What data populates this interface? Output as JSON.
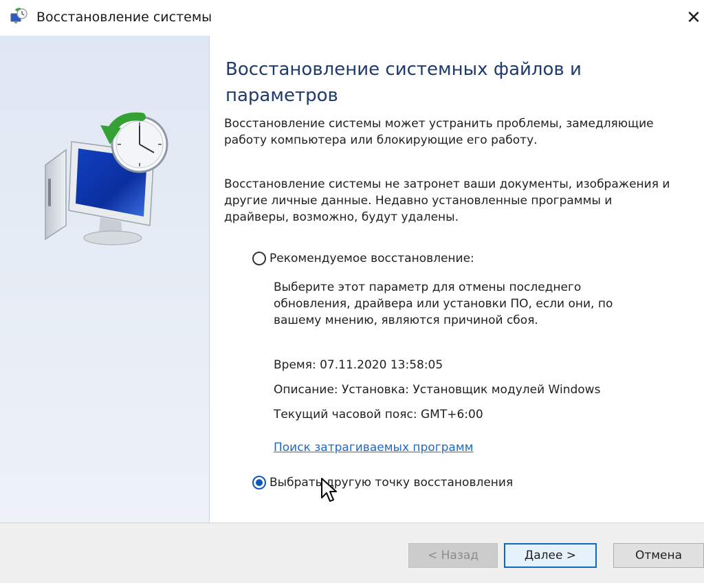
{
  "window": {
    "title": "Восстановление системы",
    "close_glyph": "✕"
  },
  "main": {
    "heading": "Восстановление системных файлов и параметров",
    "intro": "Восстановление системы может устранить проблемы, замедляющие работу компьютера или блокирующие его работу.",
    "note": "Восстановление системы не затронет ваши документы, изображения и другие личные данные. Недавно установленные программы и драйверы, возможно, будут удалены."
  },
  "options": {
    "recommended": {
      "label": "Рекомендуемое восстановление:",
      "selected": false,
      "description": "Выберите этот параметр для отмены последнего обновления, драйвера или установки ПО, если они, по вашему мнению, являются причиной сбоя.",
      "time": "Время: 07.11.2020 13:58:05",
      "desc_line": "Описание: Установка: Установщик модулей Windows",
      "timezone": "Текущий часовой пояс: GMT+6:00",
      "link": "Поиск затрагиваемых программ"
    },
    "other": {
      "label": "Выбрать другую точку восстановления",
      "selected": true
    }
  },
  "buttons": {
    "back": "< Назад",
    "next": "Далее >",
    "cancel": "Отмена"
  },
  "icons": {
    "app": "system-restore-icon",
    "hero": "system-restore-monitor-clock-icon",
    "close": "close-icon",
    "cursor": "mouse-pointer-icon"
  },
  "colors": {
    "heading": "#1e3a6e",
    "link": "#1c69c9",
    "accent": "#0a58b8",
    "side_panel": "#e3eaf4"
  }
}
